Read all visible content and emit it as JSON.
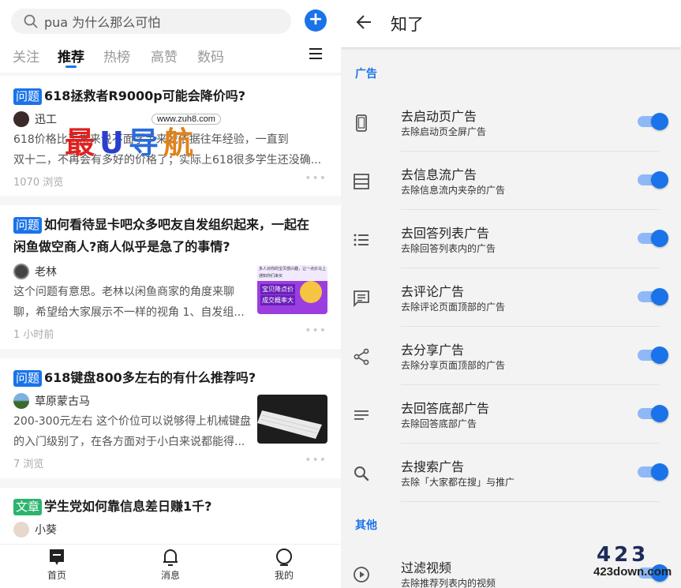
{
  "feed": {
    "search_value": "pua 为什么那么可怕",
    "tabs": [
      "关注",
      "推荐",
      "热榜",
      "高赞",
      "数码"
    ],
    "active_tab": "推荐",
    "cards": [
      {
        "badge": "问题",
        "title": "618拯救者R9000p可能会降价吗?",
        "author": "迅工",
        "excerpt_line1": "618价格比平常来说不面学手来我依据往年经验，一直到",
        "excerpt_line2": "双十二，不再会有多好的价格了；实际上618很多学生还没确...",
        "meta": "1070 浏览"
      },
      {
        "badge": "问题",
        "title_line1": "如何看待显卡吧众多吧友自发组织起来，一起在",
        "title_line2": "闲鱼做空商人?商人似乎是急了的事情?",
        "author": "老林",
        "excerpt_line1": "这个问题有意思。老林以闲鱼商家的角度来聊",
        "excerpt_line2": "聊，希望给大家展示不一样的视角 1、自发组...",
        "meta": "1 小时前",
        "thumb_text_top": "多人对你的宝贝感兴趣，让一点价马上",
        "thumb_text_mid": "通知你们来买",
        "thumb_text_tag1": "宝贝降点价",
        "thumb_text_tag2": "成交概率大"
      },
      {
        "badge": "问题",
        "title": "618键盘800多左右的有什么推荐吗?",
        "author": "草原蒙古马",
        "excerpt_line1": "200-300元左右 这个价位可以说够得上机械键盘",
        "excerpt_line2": "的入门级别了，在各方面对于小白来说都能得...",
        "meta": "7 浏览"
      },
      {
        "badge": "文章",
        "title": "学生党如何靠信息差日赚1千?",
        "author": "小葵"
      }
    ],
    "bottom_nav": [
      "首页",
      "消息",
      "我的"
    ],
    "watermark": {
      "text1": "最",
      "text2": "U",
      "text3": "导",
      "text4": "航",
      "url": "www.zuh8.com"
    }
  },
  "settings": {
    "title": "知了",
    "section_ads": "广告",
    "section_other": "其他",
    "rows": [
      {
        "title": "去启动页广告",
        "sub": "去除启动页全屏广告",
        "icon": "phone-icon",
        "on": true
      },
      {
        "title": "去信息流广告",
        "sub": "去除信息流内夹杂的广告",
        "icon": "feed-icon",
        "on": true
      },
      {
        "title": "去回答列表广告",
        "sub": "去除回答列表内的广告",
        "icon": "list-icon",
        "on": true
      },
      {
        "title": "去评论广告",
        "sub": "去除评论页面顶部的广告",
        "icon": "comment-icon",
        "on": true
      },
      {
        "title": "去分享广告",
        "sub": "去除分享页面顶部的广告",
        "icon": "share-icon",
        "on": true
      },
      {
        "title": "去回答底部广告",
        "sub": "去除回答底部广告",
        "icon": "lines-icon",
        "on": true
      },
      {
        "title": "去搜索广告",
        "sub": "去除「大家都在搜」与推广",
        "icon": "search-icon",
        "on": true
      }
    ],
    "other_rows": [
      {
        "title": "过滤视频",
        "sub": "去除推荐列表内的视频",
        "icon": "play-icon",
        "on": true
      }
    ],
    "logo": {
      "number": "423",
      "domain": "423down.com"
    }
  },
  "colors": {
    "accent": "#1a73e8",
    "toggle_track": "#8fb8f6",
    "badge_article": "#2db36e"
  }
}
